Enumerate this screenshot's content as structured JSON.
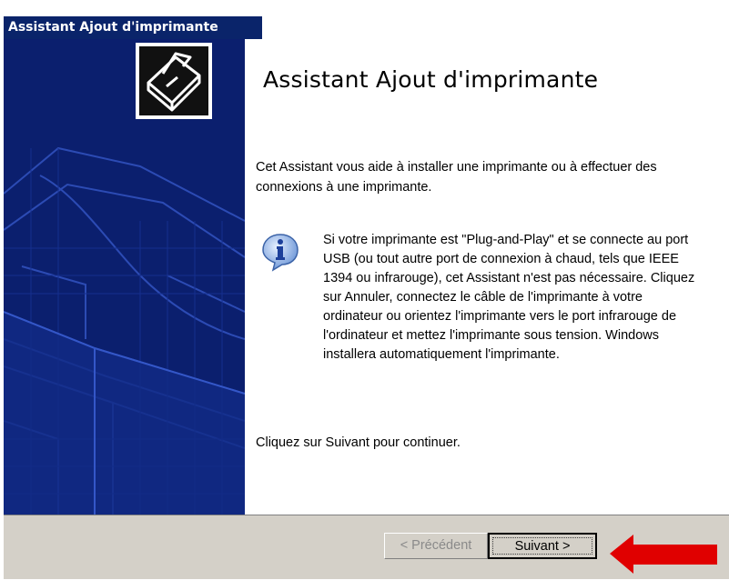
{
  "window": {
    "title": "Assistant Ajout d'imprimante"
  },
  "wizard": {
    "heading": "Assistant Ajout d'imprimante",
    "intro": "Cet Assistant vous aide à installer une imprimante ou à effectuer des connexions à une imprimante.",
    "info_text": "Si votre imprimante est \"Plug-and-Play\" et se connecte au port USB (ou tout autre port de connexion à chaud, tels que IEEE 1394 ou infrarouge), cet Assistant n'est pas nécessaire. Cliquez sur Annuler, connectez le câble de l'imprimante à votre ordinateur ou orientez l'imprimante vers le port infrarouge de l'ordinateur et mettez l'imprimante sous tension. Windows installera automatiquement l'imprimante.",
    "continue_text": "Cliquez sur Suivant pour continuer."
  },
  "buttons": {
    "previous": "< Précédent",
    "next": "Suivant >"
  },
  "colors": {
    "titlebar": "#0a246a",
    "side_panel": "#0b1f6e",
    "footer": "#d4d0c8",
    "arrow": "#e00000"
  },
  "icons": {
    "logo": "printer-icon",
    "info": "info-icon",
    "arrow": "red-arrow-left"
  }
}
